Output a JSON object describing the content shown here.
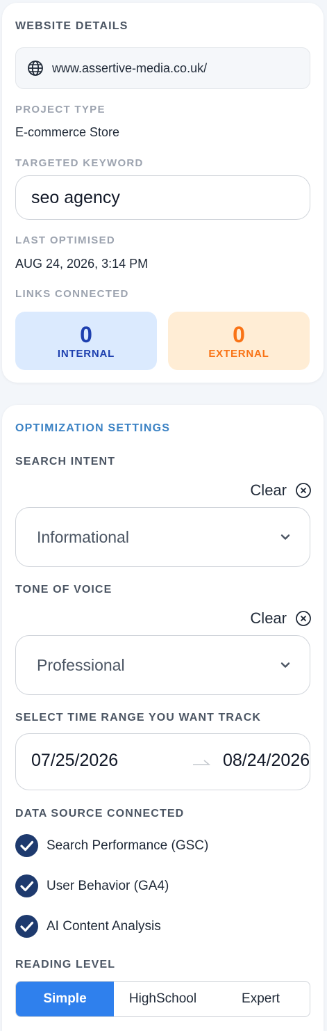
{
  "website": {
    "section_title": "WEBSITE DETAILS",
    "url": "www.assertive-media.co.uk/",
    "project_type_label": "PROJECT TYPE",
    "project_type": "E-commerce Store",
    "keyword_label": "TARGETED KEYWORD",
    "keyword": "seo agency",
    "last_optimised_label": "LAST OPTIMISED",
    "last_optimised": "AUG 24, 2026, 3:14 PM",
    "links_label": "LINKS CONNECTED",
    "links": {
      "internal_count": "0",
      "internal_label": "INTERNAL",
      "external_count": "0",
      "external_label": "EXTERNAL"
    }
  },
  "optimization": {
    "section_title": "OPTIMIZATION SETTINGS",
    "search_intent_label": "SEARCH INTENT",
    "search_intent_clear": "Clear",
    "search_intent_value": "Informational",
    "tone_label": "TONE OF VOICE",
    "tone_clear": "Clear",
    "tone_value": "Professional",
    "time_range_label": "SELECT TIME RANGE YOU WANT TRACK",
    "date_start": "07/25/2026",
    "date_end": "08/24/2026",
    "data_source_label": "DATA SOURCE CONNECTED",
    "data_sources": [
      {
        "label": "Search Performance (GSC)",
        "checked": true
      },
      {
        "label": "User Behavior (GA4)",
        "checked": true
      },
      {
        "label": "AI Content Analysis",
        "checked": true
      }
    ],
    "reading_level_label": "READING LEVEL",
    "reading_levels": [
      "Simple",
      "HighSchool",
      "Expert"
    ],
    "reading_level_selected": "Simple"
  },
  "colors": {
    "accent": "#2f80ed",
    "section_title_blue": "#3b82c4",
    "check_navy": "#1e3a6e",
    "internal_bg": "#dbeafe",
    "internal_text": "#1e40af",
    "external_bg": "#ffedd5",
    "external_text": "#f97316"
  },
  "icons": {
    "url": "globe-icon",
    "clear": "close-circle-icon",
    "select": "chevron-down-icon",
    "date_separator": "arrow-right-icon",
    "data_source": "check-circle-icon"
  }
}
